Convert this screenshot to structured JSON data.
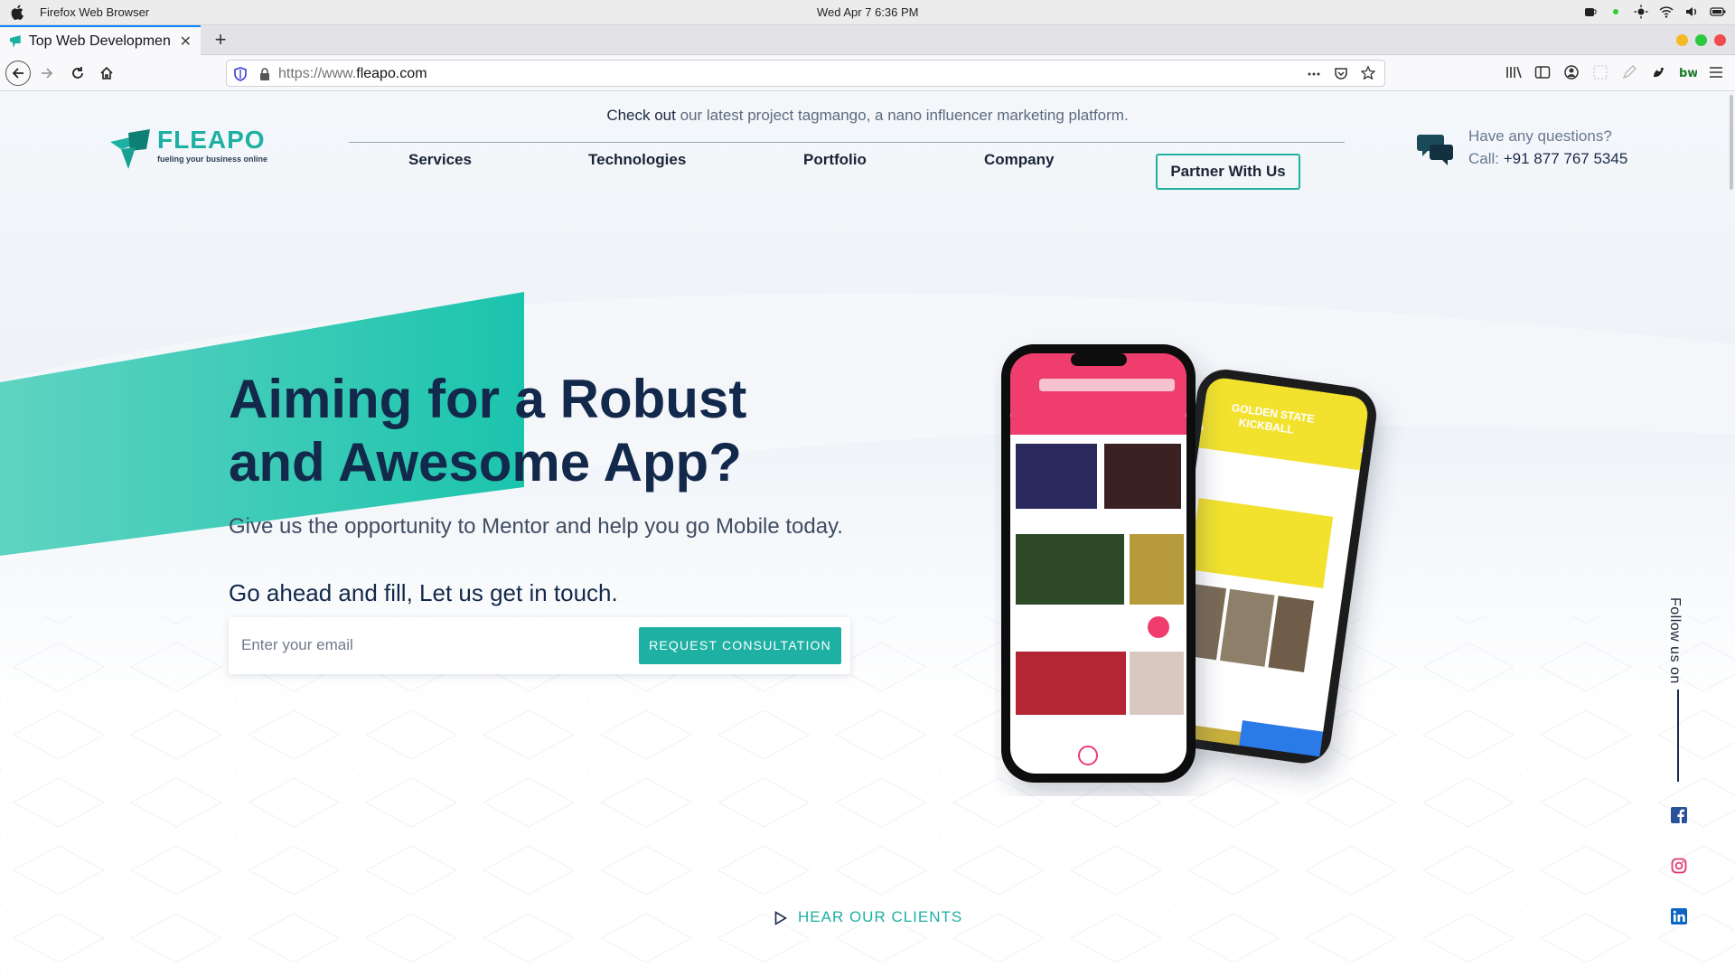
{
  "menubar": {
    "app_name": "Firefox Web Browser",
    "clock": "Wed Apr 7   6:36 PM"
  },
  "browser": {
    "tab_title": "Top Web Development",
    "url_prefix": "https://www.",
    "url_domain": "fleapo.com"
  },
  "site": {
    "announcement_bold": "Check out",
    "announcement_rest": " our latest project tagmango, a nano influencer marketing platform.",
    "logo_word": "FLEAPO",
    "logo_tagline": "fueling your business online",
    "nav": [
      "Services",
      "Technologies",
      "Portfolio",
      "Company"
    ],
    "partner_label": "Partner With Us",
    "contact_question": "Have any questions?",
    "contact_call_label": "Call: ",
    "contact_phone": "+91 877 767 5345",
    "hero_title_line1": "Aiming for a Robust",
    "hero_title_line2": "and Awesome App?",
    "hero_subtitle": "Give us the opportunity to Mentor and help you go Mobile today.",
    "hero_cta": "Go ahead and fill, Let us get in touch.",
    "email_placeholder": "Enter your email",
    "request_button": "REQUEST CONSULTATION",
    "follow_label": "Follow us on",
    "hear_clients": "HEAR OUR CLIENTS"
  },
  "colors": {
    "accent": "#1eb0a3",
    "navy": "#13294b",
    "tab_highlight": "#0a84ff"
  },
  "icons": [
    "apple-icon",
    "back-icon",
    "forward-icon",
    "reload-icon",
    "home-icon",
    "shield-icon",
    "lock-icon",
    "chat-bubble-icon",
    "facebook-icon",
    "instagram-icon",
    "linkedin-icon",
    "play-icon"
  ]
}
